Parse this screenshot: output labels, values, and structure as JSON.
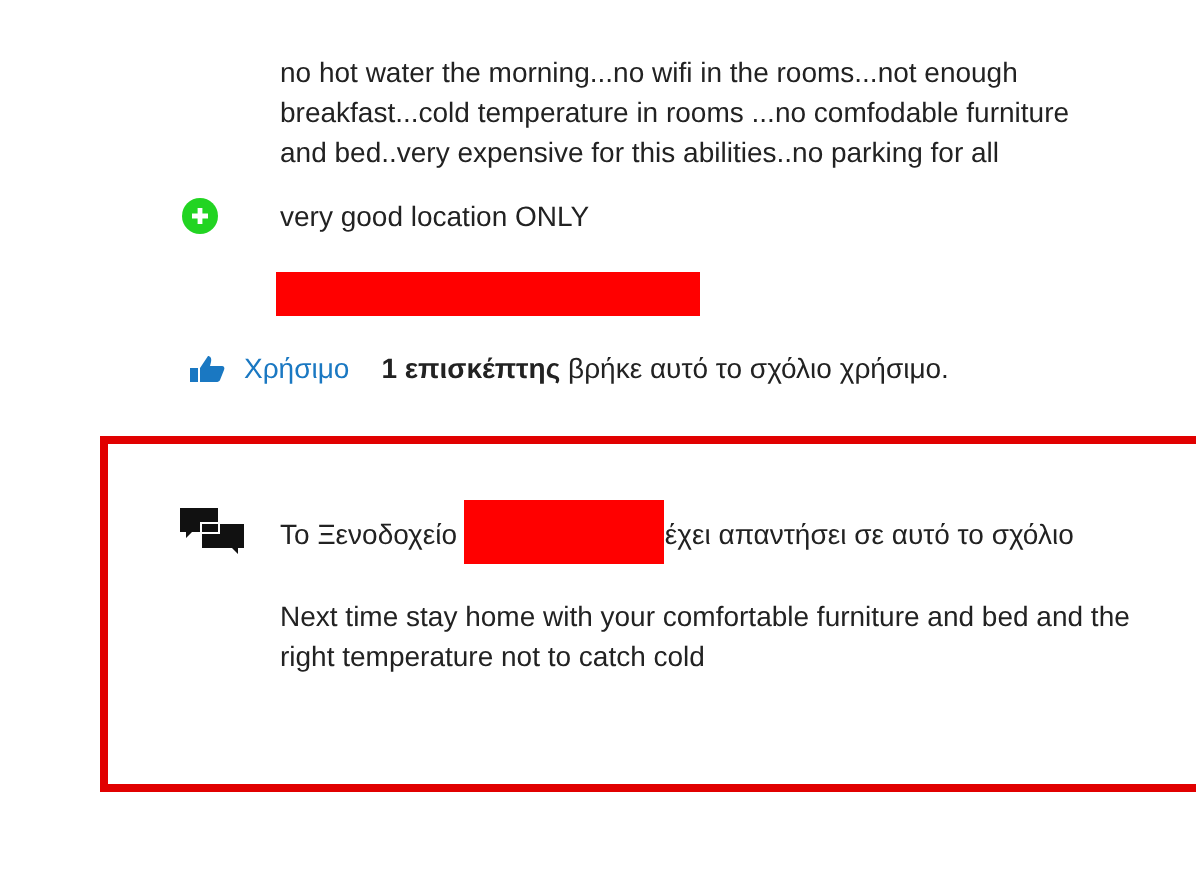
{
  "review": {
    "text": "no hot water the morning...no wifi in the rooms...not enough breakfast...cold temperature in rooms ...no comfodable furniture and bed..very expensive for this abilities..no parking for all",
    "positive": "very good location ONLY",
    "helpful": {
      "link": "Χρήσιμο",
      "text": "**1 επισκέπτης** βρήκε αυτό το σχόλιο χρήσιμο."
    }
  },
  "reply": {
    "header_start": "Το Ξενοδοχείο",
    "header_end": "έχει απαντήσει σε αυτό το σχόλιο",
    "text": "Next time stay home with your comfortable furniture and bed and the right temperature not to catch cold"
  }
}
